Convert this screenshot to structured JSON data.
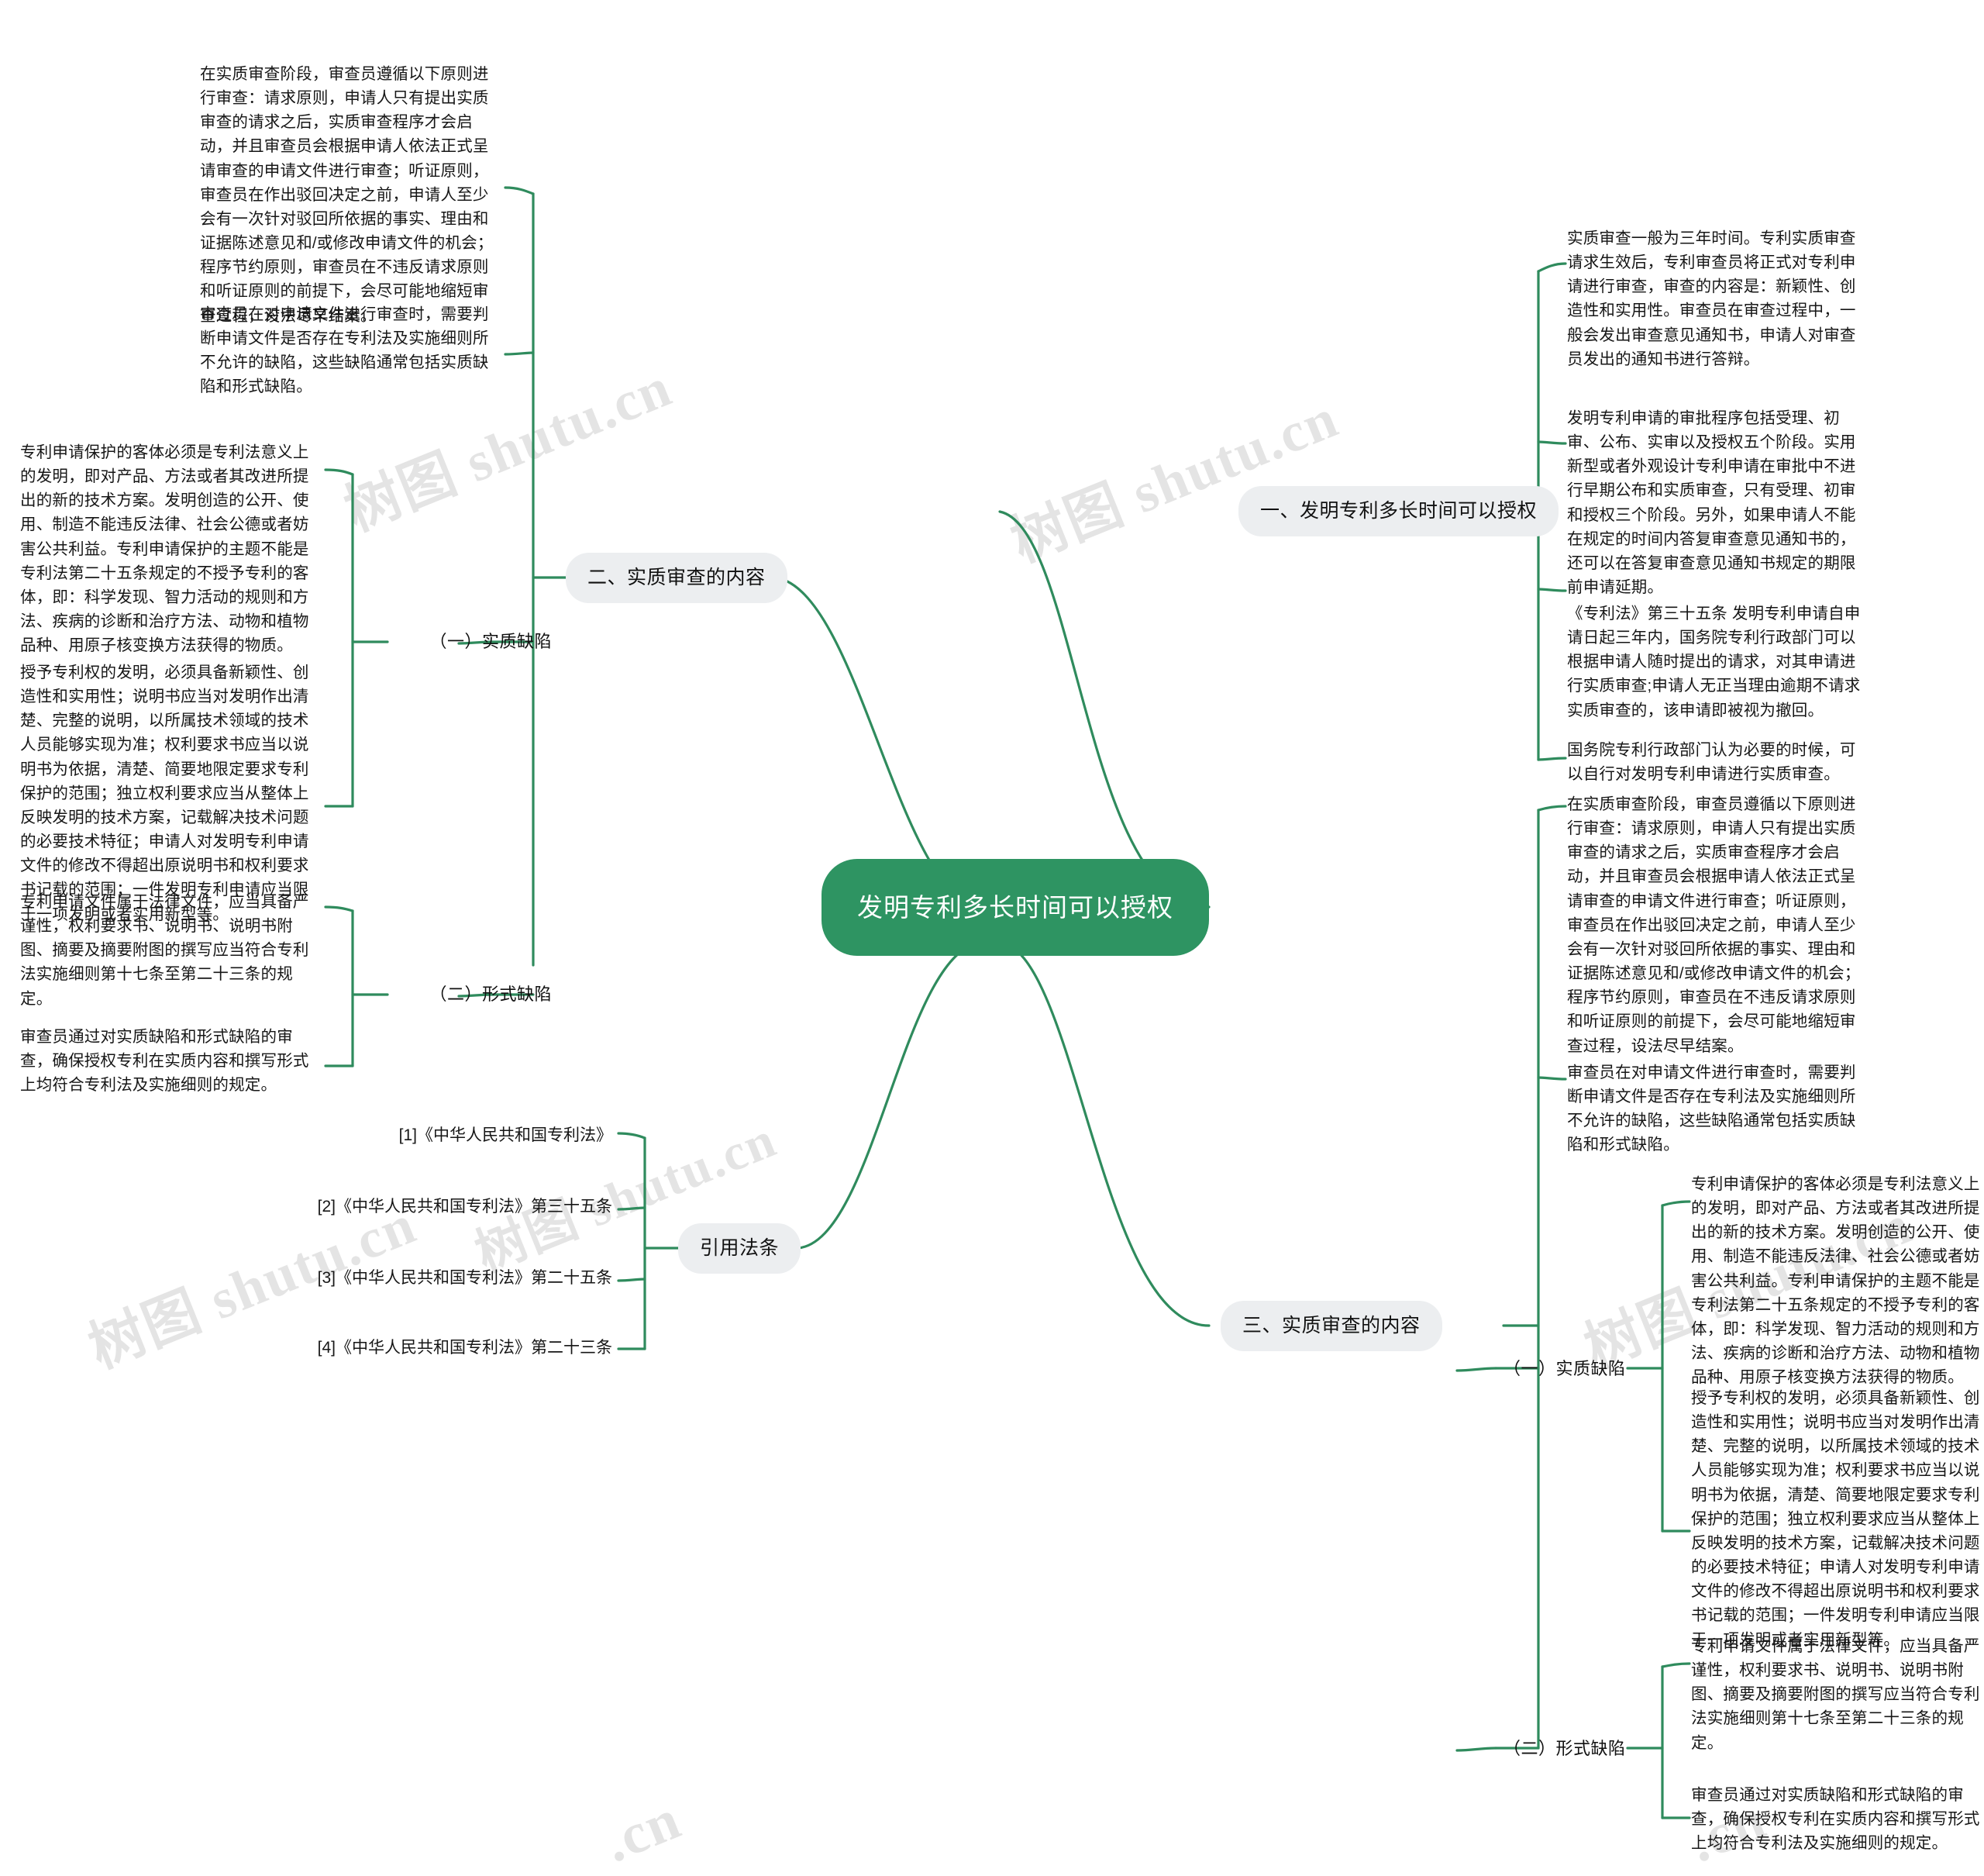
{
  "root": {
    "title": "发明专利多长时间可以授权"
  },
  "colors": {
    "accent_green": "#2e9462",
    "branch_line": "#2f8b5d",
    "pill_bg": "#eceef0",
    "text": "#161616",
    "page_bg": "#ffffff"
  },
  "watermarks": [
    {
      "text": "树图 shutu.cn"
    },
    {
      "text": "树图 shutu.cn"
    },
    {
      "text": "树图 shutu.cn"
    },
    {
      "text": "树图 shutu.cn"
    },
    {
      "text": "树图 shutu.cn"
    },
    {
      "text": ".cn"
    },
    {
      "text": ".cn"
    }
  ],
  "branches": {
    "right_top": {
      "label": "一、发明专利多长时间可以授权",
      "leaves": [
        "实质审查一般为三年时间。专利实质审查请求生效后，专利审查员将正式对专利申请进行审查，审查的内容是：新颖性、创造性和实用性。审查员在审查过程中，一般会发出审查意见通知书，申请人对审查员发出的通知书进行答辩。",
        "发明专利申请的审批程序包括受理、初审、公布、实审以及授权五个阶段。实用新型或者外观设计专利申请在审批中不进行早期公布和实质审查，只有受理、初审和授权三个阶段。另外，如果申请人不能在规定的时间内答复审查意见通知书的，还可以在答复审查意见通知书规定的期限前申请延期。",
        "《专利法》第三十五条 发明专利申请自申请日起三年内，国务院专利行政部门可以根据申请人随时提出的请求，对其申请进行实质审查;申请人无正当理由逾期不请求实质审查的，该申请即被视为撤回。",
        "国务院专利行政部门认为必要的时候，可以自行对发明专利申请进行实质审查。"
      ]
    },
    "right_bottom": {
      "label": "三、实质审查的内容",
      "direct_leaves": [
        "在实质审查阶段，审查员遵循以下原则进行审查：请求原则，申请人只有提出实质审查的请求之后，实质审查程序才会启动，并且审查员会根据申请人依法正式呈请审查的申请文件进行审查；听证原则，审查员在作出驳回决定之前，申请人至少会有一次针对驳回所依据的事实、理由和证据陈述意见和/或修改申请文件的机会；程序节约原则，审查员在不违反请求原则和听证原则的前提下，会尽可能地缩短审查过程，设法尽早结案。",
        "审查员在对申请文件进行审查时，需要判断申请文件是否存在专利法及实施细则所不允许的缺陷，这些缺陷通常包括实质缺陷和形式缺陷。"
      ],
      "sub": [
        {
          "label": "（一）实质缺陷",
          "leaves": [
            "专利申请保护的客体必须是专利法意义上的发明，即对产品、方法或者其改进所提出的新的技术方案。发明创造的公开、使用、制造不能违反法律、社会公德或者妨害公共利益。专利申请保护的主题不能是专利法第二十五条规定的不授予专利的客体，即：科学发现、智力活动的规则和方法、疾病的诊断和治疗方法、动物和植物品种、用原子核变换方法获得的物质。",
            "授予专利权的发明，必须具备新颖性、创造性和实用性；说明书应当对发明作出清楚、完整的说明，以所属技术领域的技术人员能够实现为准；权利要求书应当以说明书为依据，清楚、简要地限定要求专利保护的范围；独立权利要求应当从整体上反映发明的技术方案，记载解决技术问题的必要技术特征；申请人对发明专利申请文件的修改不得超出原说明书和权利要求书记载的范围；一件发明专利申请应当限于一项发明或者实用新型等。"
          ]
        },
        {
          "label": "（二）形式缺陷",
          "leaves": [
            "专利申请文件属于法律文件，应当具备严谨性，权利要求书、说明书、说明书附图、摘要及摘要附图的撰写应当符合专利法实施细则第十七条至第二十三条的规定。",
            "审查员通过对实质缺陷和形式缺陷的审查，确保授权专利在实质内容和撰写形式上均符合专利法及实施细则的规定。"
          ]
        }
      ]
    },
    "left_top": {
      "label": "二、实质审查的内容",
      "direct_leaves": [
        "在实质审查阶段，审查员遵循以下原则进行审查：请求原则，申请人只有提出实质审查的请求之后，实质审查程序才会启动，并且审查员会根据申请人依法正式呈请审查的申请文件进行审查；听证原则，审查员在作出驳回决定之前，申请人至少会有一次针对驳回所依据的事实、理由和证据陈述意见和/或修改申请文件的机会；程序节约原则，审查员在不违反请求原则和听证原则的前提下，会尽可能地缩短审查过程，设法尽早结案。",
        "审查员在对申请文件进行审查时，需要判断申请文件是否存在专利法及实施细则所不允许的缺陷，这些缺陷通常包括实质缺陷和形式缺陷。"
      ],
      "sub": [
        {
          "label": "（一）实质缺陷",
          "leaves": [
            "专利申请保护的客体必须是专利法意义上的发明，即对产品、方法或者其改进所提出的新的技术方案。发明创造的公开、使用、制造不能违反法律、社会公德或者妨害公共利益。专利申请保护的主题不能是专利法第二十五条规定的不授予专利的客体，即：科学发现、智力活动的规则和方法、疾病的诊断和治疗方法、动物和植物品种、用原子核变换方法获得的物质。",
            "授予专利权的发明，必须具备新颖性、创造性和实用性；说明书应当对发明作出清楚、完整的说明，以所属技术领域的技术人员能够实现为准；权利要求书应当以说明书为依据，清楚、简要地限定要求专利保护的范围；独立权利要求应当从整体上反映发明的技术方案，记载解决技术问题的必要技术特征；申请人对发明专利申请文件的修改不得超出原说明书和权利要求书记载的范围；一件发明专利申请应当限于一项发明或者实用新型等。"
          ]
        },
        {
          "label": "（二）形式缺陷",
          "leaves": [
            "专利申请文件属于法律文件，应当具备严谨性，权利要求书、说明书、说明书附图、摘要及摘要附图的撰写应当符合专利法实施细则第十七条至第二十三条的规定。",
            "审查员通过对实质缺陷和形式缺陷的审查，确保授权专利在实质内容和撰写形式上均符合专利法及实施细则的规定。"
          ]
        }
      ]
    },
    "left_bottom": {
      "label": "引用法条",
      "citations": [
        "[1]《中华人民共和国专利法》",
        "[2]《中华人民共和国专利法》第三十五条",
        "[3]《中华人民共和国专利法》第二十五条",
        "[4]《中华人民共和国专利法》第二十三条"
      ]
    }
  }
}
